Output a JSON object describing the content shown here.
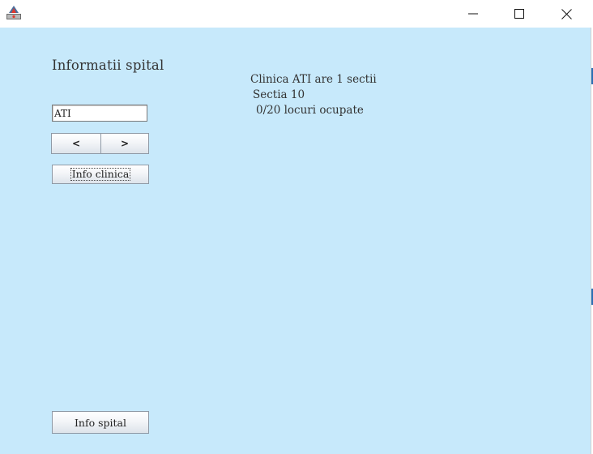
{
  "window": {
    "title": "",
    "controls": [
      "minimize",
      "maximize",
      "close"
    ],
    "background": "#c7e9fb"
  },
  "heading": "Informatii spital",
  "clinic_input": {
    "value": "ATI"
  },
  "nav": {
    "prev_label": "<",
    "next_label": ">"
  },
  "buttons": {
    "info_clinica": "Info clinica",
    "info_spital": "Info spital"
  },
  "info": {
    "clinic_summary": "Clinica ATI are 1 sectii",
    "section": "Sectia 10",
    "occupancy": "0/20 locuri ocupate"
  }
}
